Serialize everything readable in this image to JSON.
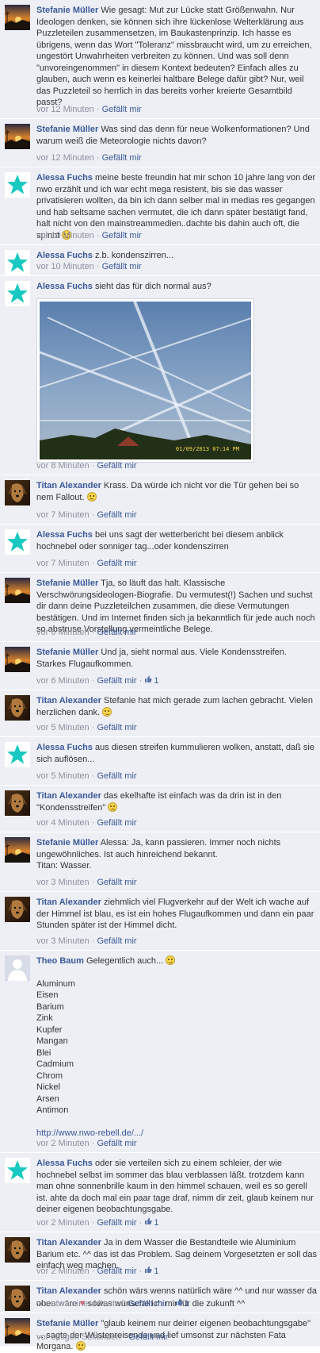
{
  "like_label": "Gefällt mir",
  "dot": "·",
  "thumbs_icon": "thumbs-up-icon",
  "comments": [
    {
      "author": "Stefanie Müller",
      "avatar": "sunset-avatar",
      "text": "Wie gesagt: Mut zur Lücke statt Größenwahn. Nur Ideologen denken, sie können sich ihre lückenlose Welterklärung aus Puzzleteilen zusammensetzen, im Baukastenprinzip. Ich hasse es übrigens, wenn das Wort \"Toleranz\" missbraucht wird, um zu erreichen, ungestört Unwahrheiten verbreiten zu können. Und was soll denn \"unvoreingenommen\" in diesem Kontext bedeuten? Einfach alles zu glauben, auch wenn es keinerlei haltbare Belege dafür gibt? Nur, weil das Puzzleteil so herrlich in das bereits vorher kreierte Gesamtbild passt?",
      "time": "vor 12 Minuten"
    },
    {
      "author": "Stefanie Müller",
      "avatar": "sunset-avatar",
      "text": "Was sind das denn für neue Wolkenformationen? Und warum weiß die Meteorologie nichts davon?",
      "time": "vor 12 Minuten"
    },
    {
      "author": "Alessa Fuchs",
      "avatar": "star-avatar",
      "text": "meine beste freundin hat mir schon 10 jahre lang von der nwo erzählt und ich war echt mega resistent, bis sie das wasser privatisieren wollten, da bin ich dann selber mal in medias res gegangen und hab seltsame sachen vermutet, die ich dann später bestätigt fand, halt nicht von den mainstreammedien..dachte bis dahin auch oft, die spinnt",
      "time": "vor 10 Minuten"
    },
    {
      "author": "Alessa Fuchs",
      "avatar": "star-avatar",
      "text": "z.b. kondenszirren...",
      "time": "vor 10 Minuten"
    },
    {
      "author": "Alessa Fuchs",
      "avatar": "star-avatar",
      "text": "sieht das für dich normal aus?",
      "photo_timestamp": "01/09/2013 07:14 PM",
      "time": "vor 8 Minuten"
    },
    {
      "author": "Titan Alexander",
      "avatar": "dog-avatar",
      "text": "Krass. Da würde ich nicht vor die Tür gehen bei so nem Fallout.",
      "time": "vor 7 Minuten"
    },
    {
      "author": "Alessa Fuchs",
      "avatar": "star-avatar",
      "text": "bei uns sagt der wetterbericht bei diesem anblick hochnebel oder sonniger tag...oder kondenszirren",
      "time": "vor 7 Minuten"
    },
    {
      "author": "Stefanie Müller",
      "avatar": "sunset-avatar",
      "text": "Tja, so läuft das halt. Klassische Verschwörungsideologen-Biografie. Du vermutest(!) Sachen und suchst dir dann deine Puzzleteilchen zusammen, die diese Vermutungen bestätigen. Und im Internet finden sich ja bekanntlich für jede auch noch so abstruse Vorstellung vermeintliche Belege.",
      "time": "vor 6 Minuten"
    },
    {
      "author": "Stefanie Müller",
      "avatar": "sunset-avatar",
      "text": "Und ja, sieht normal aus. Viele Kondensstreifen. Starkes Flugaufkommen.",
      "time": "vor 6 Minuten",
      "likes": "1"
    },
    {
      "author": "Titan Alexander",
      "avatar": "dog-avatar",
      "text": "Stefanie hat mich gerade zum lachen gebracht. Vielen herzlichen dank.",
      "time": "vor 5 Minuten"
    },
    {
      "author": "Alessa Fuchs",
      "avatar": "star-avatar",
      "text": "aus diesen streifen kummulieren wolken, anstatt, daß sie sich auflösen...",
      "time": "vor 5 Minuten"
    },
    {
      "author": "Titan Alexander",
      "avatar": "dog-avatar",
      "text": "das ekelhafte ist einfach was da drin ist in den \"Kondensstreifen\"",
      "time": "vor 4 Minuten"
    },
    {
      "author": "Stefanie Müller",
      "avatar": "sunset-avatar",
      "text": "Alessa: Ja, kann passieren. Immer noch nichts ungewöhnliches. Ist auch hinreichend bekannt.\nTitan: Wasser.",
      "time": "vor 3 Minuten"
    },
    {
      "author": "Titan Alexander",
      "avatar": "dog-avatar",
      "text": "ziehmlich viel Flugverkehr auf der Welt ich wache auf der Himmel ist blau, es ist ein hohes Flugaufkommen und dann ein paar Stunden später ist der Himmel dicht.",
      "time": "vor 3 Minuten"
    },
    {
      "author": "Theo Baum",
      "avatar": "silhouette-avatar",
      "text": "Gelegentlich auch...",
      "list": [
        "Aluminum",
        "Eisen",
        "Barium",
        "Zink",
        "Kupfer",
        "Mangan",
        "Blei",
        "Cadmium",
        "Chrom",
        "Nickel",
        "Arsen",
        "Antimon"
      ],
      "link": "http://www.nwo-rebell.de/.../",
      "time": "vor 2 Minuten"
    },
    {
      "author": "Alessa Fuchs",
      "avatar": "star-avatar",
      "text": "oder sie verteilen sich zu einem schleier, der wie hochnebel selbst im sommer das blau verblassen läßt. trotzdem kann man ohne sonnenbrille kaum in den himmel schauen, weil es so gerell ist. ahte da doch mal ein paar tage draf, nimm dir zeit, glaub keinem nur deiner eigenen beobachtungsgabe.",
      "time": "vor 2 Minuten",
      "likes": "1"
    },
    {
      "author": "Titan Alexander",
      "avatar": "dog-avatar",
      "text": "Ja in dem Wasser die Bestandteile wie Aluminium Barium etc. ^^ das ist das Problem. Sag deinem Vorgesetzten er soll das einfach weg machen.",
      "time": "vor 2 Minuten",
      "likes": "1"
    },
    {
      "author": "Titan Alexander",
      "avatar": "dog-avatar",
      "text_a": "schön wärs wenns natürlich wäre ^^ und nur wasser da oben wäre",
      "text_b": "sowas wünsche ich mir für die zukunft ^^",
      "time": "vor etwa einer Minute",
      "likes": "1"
    },
    {
      "author": "Stefanie Müller",
      "avatar": "sunset-avatar",
      "text": "\"glaub keinem nur deiner eigenen beobachtungsgabe\" ... sagte der Wüstenreisende und lief umsonst zur nächsten Fata Morgana.",
      "time": "vor einigen Sekunden"
    }
  ]
}
